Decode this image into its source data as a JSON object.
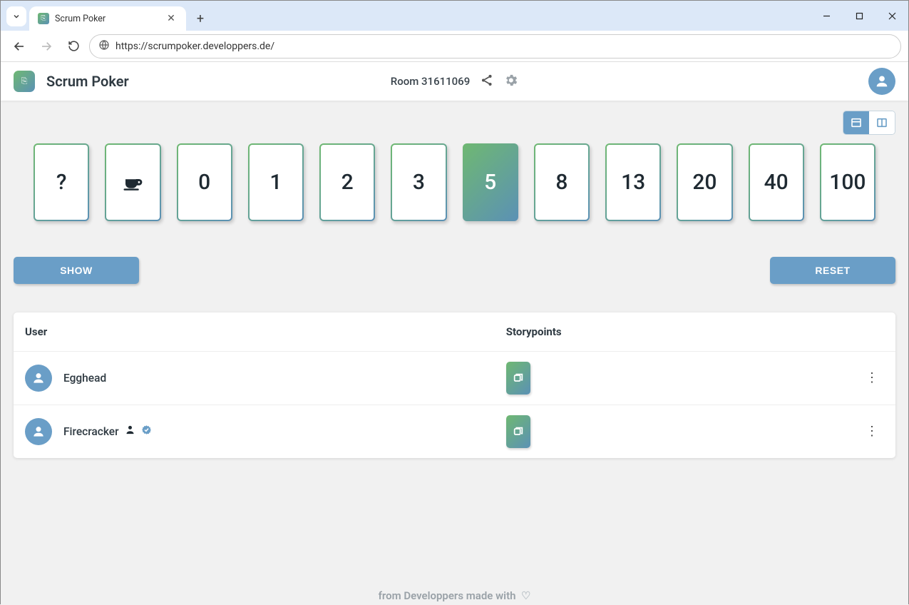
{
  "browser": {
    "tab_title": "Scrum Poker",
    "url": "https://scrumpoker.developpers.de/"
  },
  "header": {
    "app_title": "Scrum Poker",
    "room_label": "Room 31611069"
  },
  "cards": [
    {
      "label": "?",
      "selected": false,
      "is_icon": false
    },
    {
      "label": "coffee",
      "selected": false,
      "is_icon": true
    },
    {
      "label": "0",
      "selected": false,
      "is_icon": false
    },
    {
      "label": "1",
      "selected": false,
      "is_icon": false
    },
    {
      "label": "2",
      "selected": false,
      "is_icon": false
    },
    {
      "label": "3",
      "selected": false,
      "is_icon": false
    },
    {
      "label": "5",
      "selected": true,
      "is_icon": false
    },
    {
      "label": "8",
      "selected": false,
      "is_icon": false
    },
    {
      "label": "13",
      "selected": false,
      "is_icon": false
    },
    {
      "label": "20",
      "selected": false,
      "is_icon": false
    },
    {
      "label": "40",
      "selected": false,
      "is_icon": false
    },
    {
      "label": "100",
      "selected": false,
      "is_icon": false
    }
  ],
  "buttons": {
    "show": "SHOW",
    "reset": "RESET"
  },
  "table": {
    "col_user": "User",
    "col_points": "Storypoints",
    "rows": [
      {
        "name": "Egghead",
        "is_self": false,
        "verified": false,
        "voted": true
      },
      {
        "name": "Firecracker",
        "is_self": true,
        "verified": true,
        "voted": true
      }
    ]
  },
  "footer": {
    "text": "from Developpers made with"
  },
  "view_mode": "list"
}
